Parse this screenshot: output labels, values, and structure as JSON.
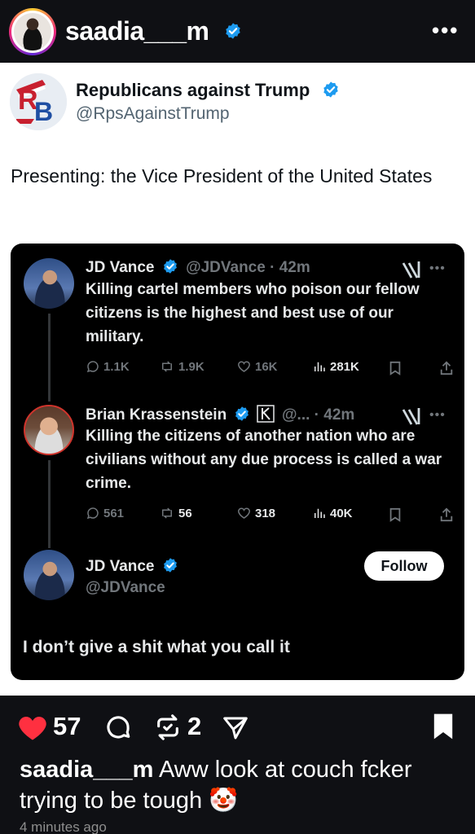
{
  "header": {
    "username": "saadia___m",
    "more_label": "•••"
  },
  "post": {
    "author_name": "Republicans against Trump",
    "author_handle": "@RpsAgainstTrump",
    "text": "Presenting: the Vice President of the United States"
  },
  "thread": {
    "tweets": [
      {
        "name": "JD Vance",
        "handle_time": "@JDVance · 42m",
        "text": "Killing cartel members who poison our fellow citizens is the highest and best use of our military.",
        "replies": "1.1K",
        "reposts": "1.9K",
        "likes": "16K",
        "views": "281K"
      },
      {
        "name": "Brian Krassenstein",
        "handle_time": "@... · 42m",
        "text": "Killing the citizens of another nation who are civilians without any due process is called a war crime.",
        "replies": "561",
        "reposts": "56",
        "likes": "318",
        "views": "40K"
      }
    ],
    "quoted": {
      "name": "JD Vance",
      "handle": "@JDVance",
      "follow_label": "Follow",
      "text": "I don’t give a shit what you call it"
    }
  },
  "footer": {
    "like_count": "57",
    "repost_count": "2",
    "caption_user": "saadia___m",
    "caption_text": "Aww look at couch fcker trying to be tough",
    "caption_emoji": "🤡",
    "timestamp": "4 minutes ago"
  },
  "colors": {
    "verified": "#1d9bf0",
    "like_heart": "#ff3040",
    "follow_bg": "#ffffff"
  },
  "icons": [
    "verified-icon",
    "more-icon",
    "grok-icon",
    "reply-icon",
    "repost-icon",
    "like-icon",
    "views-icon",
    "bookmark-icon",
    "share-icon",
    "heart-icon",
    "comment-icon",
    "send-icon",
    "save-icon"
  ]
}
